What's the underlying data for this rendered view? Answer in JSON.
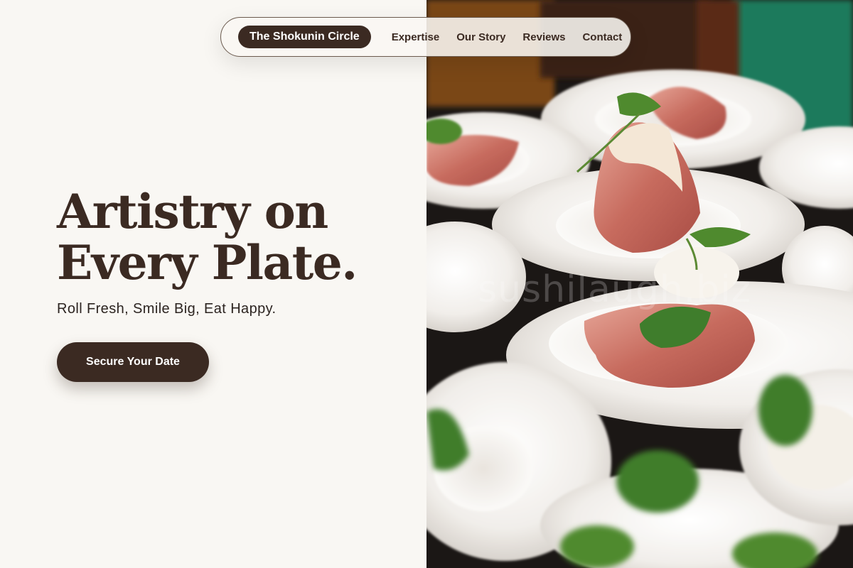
{
  "nav": {
    "brand": "The Shokunin Circle",
    "links": [
      "Expertise",
      "Our Story",
      "Reviews",
      "Contact"
    ]
  },
  "hero": {
    "title_line1": "Artistry on",
    "title_line2": "Every Plate.",
    "tagline": "Roll Fresh, Smile Big, Eat Happy.",
    "cta_label": "Secure Your Date"
  },
  "image": {
    "description_icon": "plated-prosciutto-photo",
    "watermark": "sushilaugh.biz"
  },
  "colors": {
    "accent": "#3b2a22",
    "background": "#f9f7f3",
    "text": "#3b2a22"
  }
}
